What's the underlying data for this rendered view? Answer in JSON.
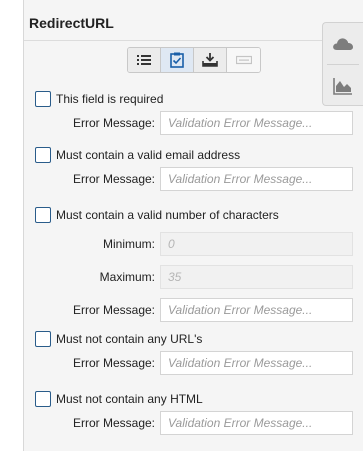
{
  "panel": {
    "title": "RedirectURL"
  },
  "toolbar": {
    "buttons": [
      {
        "icon": "list-icon",
        "active": false
      },
      {
        "icon": "clipboard-check-icon",
        "active": true
      },
      {
        "icon": "download-tray-icon",
        "active": false
      },
      {
        "icon": "field-input-icon",
        "active": false
      }
    ]
  },
  "side_rail": {
    "buttons": [
      {
        "icon": "cloud-icon"
      },
      {
        "icon": "area-chart-icon"
      }
    ]
  },
  "validations": {
    "required": {
      "label": "This field is required",
      "error_label": "Error Message:",
      "error_placeholder": "Validation Error Message..."
    },
    "email": {
      "label": "Must contain a valid email address",
      "error_label": "Error Message:",
      "error_placeholder": "Validation Error Message..."
    },
    "char_count": {
      "label": "Must contain a valid number of characters",
      "min_label": "Minimum:",
      "min_placeholder": "0",
      "max_label": "Maximum:",
      "max_placeholder": "35",
      "error_label": "Error Message:",
      "error_placeholder": "Validation Error Message..."
    },
    "no_urls": {
      "label": "Must not contain any URL's",
      "error_label": "Error Message:",
      "error_placeholder": "Validation Error Message..."
    },
    "no_html": {
      "label": "Must not contain any HTML",
      "error_label": "Error Message:",
      "error_placeholder": "Validation Error Message..."
    }
  },
  "colors": {
    "checkbox_border": "#2a5c8a",
    "panel_bg": "#f5f5f5",
    "active_tool": "#1a5fa8"
  }
}
